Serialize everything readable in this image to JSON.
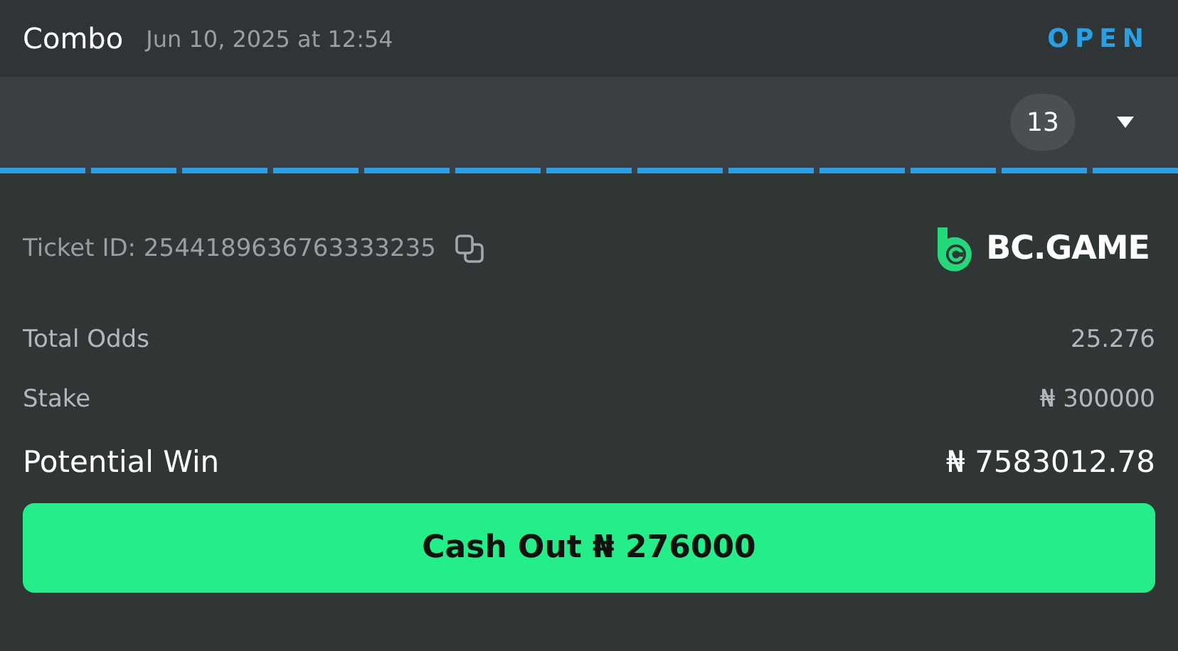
{
  "header": {
    "title": "Combo",
    "datetime": "Jun 10, 2025 at 12:54",
    "status": "OPEN"
  },
  "legs_bar": {
    "count": "13",
    "expanded": false,
    "segments": [
      {
        "color": "#2a9fe3"
      },
      {
        "color": "#2a9fe3"
      },
      {
        "color": "#2a9fe3"
      },
      {
        "color": "#2a9fe3"
      },
      {
        "color": "#2a9fe3"
      },
      {
        "color": "#2a9fe3"
      },
      {
        "color": "#2a9fe3"
      },
      {
        "color": "#2a9fe3"
      },
      {
        "color": "#2a9fe3"
      },
      {
        "color": "#2a9fe3"
      },
      {
        "color": "#2a9fe3"
      },
      {
        "color": "#2a9fe3"
      },
      {
        "color": "#2a9fe3"
      }
    ]
  },
  "ticket": {
    "id_label": "Ticket ID: 2544189636763333235",
    "brand": "BC.GAME"
  },
  "summary": [
    {
      "label": "Total Odds",
      "value": "25.276",
      "kind": "minor"
    },
    {
      "label": "Stake",
      "value": "₦ 300000",
      "kind": "minor"
    },
    {
      "label": "Potential Win",
      "value": "₦ 7583012.78",
      "kind": "major"
    }
  ],
  "cash_out_button": "Cash Out ₦ 276000"
}
